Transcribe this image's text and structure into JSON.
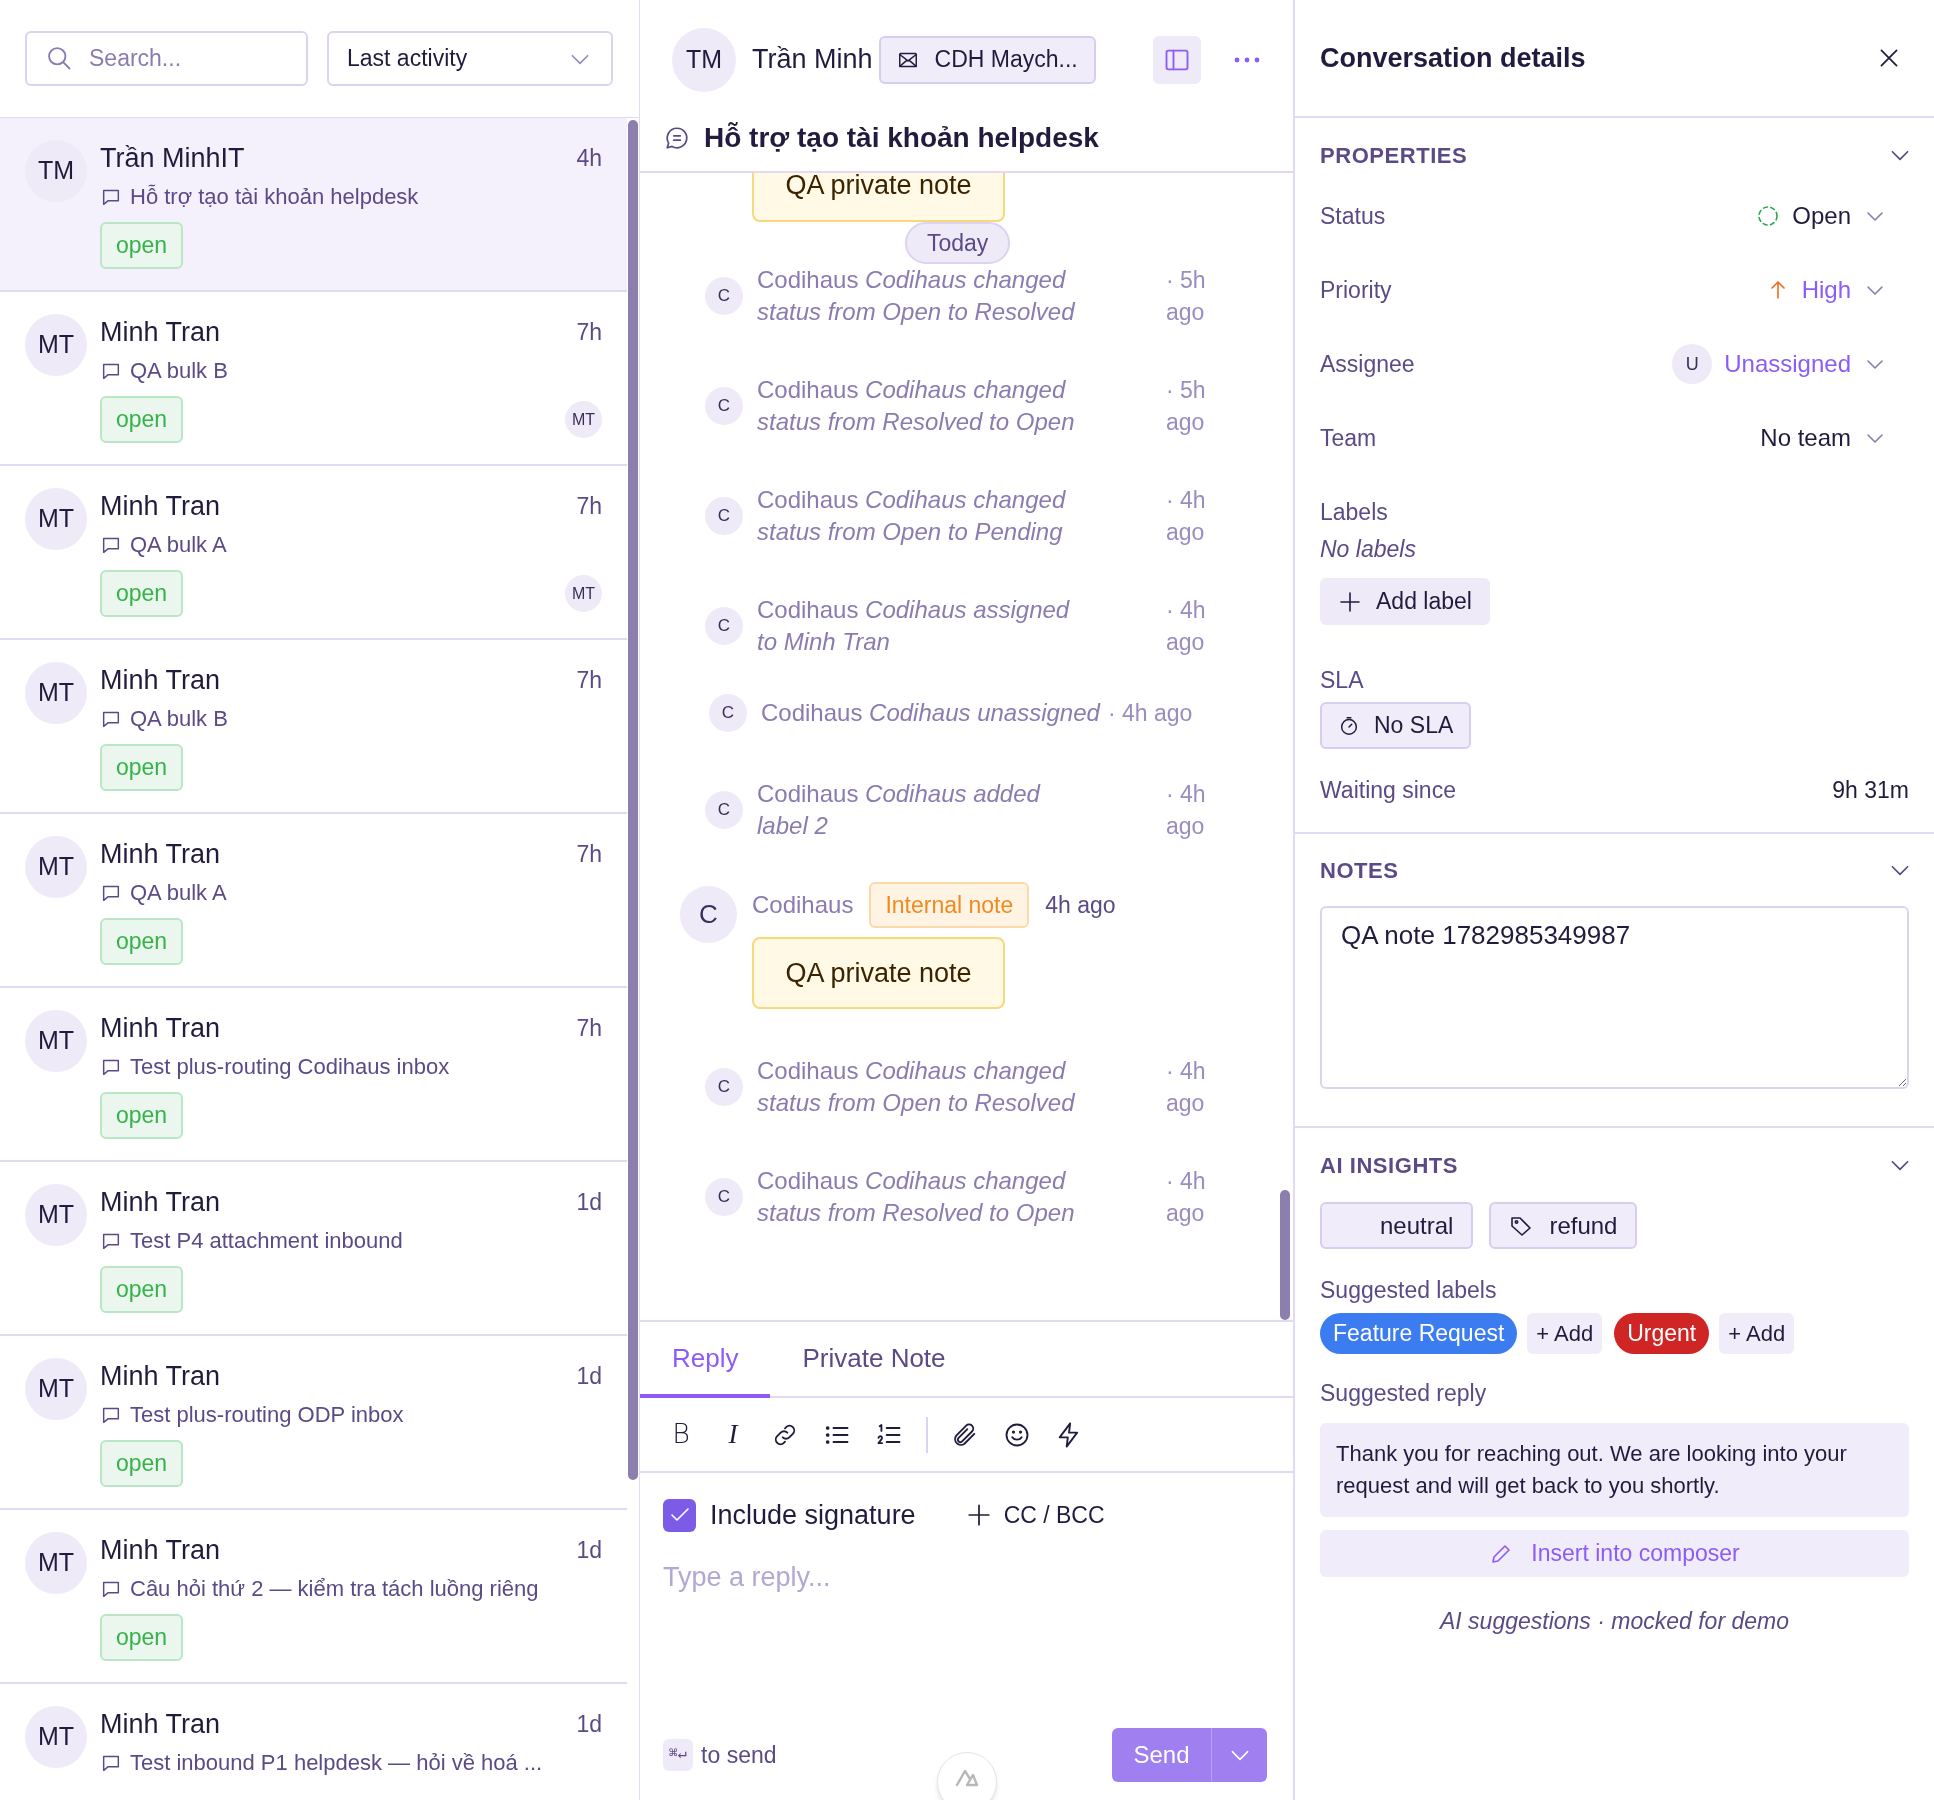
{
  "sidebar": {
    "search": {
      "placeholder": "Search..."
    },
    "sort": {
      "value": "Last activity"
    },
    "conversations": [
      {
        "initials": "TM",
        "name": "Trần MinhIT",
        "time": "4h",
        "subject": "Hỗ trợ tạo tài khoản helpdesk",
        "status": "open",
        "selected": true
      },
      {
        "initials": "MT",
        "name": "Minh Tran",
        "time": "7h",
        "subject": "QA bulk B",
        "status": "open",
        "assignee_initials": "MT",
        "selected": false
      },
      {
        "initials": "MT",
        "name": "Minh Tran",
        "time": "7h",
        "subject": "QA bulk A",
        "status": "open",
        "assignee_initials": "MT",
        "selected": false
      },
      {
        "initials": "MT",
        "name": "Minh Tran",
        "time": "7h",
        "subject": "QA bulk B",
        "status": "open",
        "selected": false
      },
      {
        "initials": "MT",
        "name": "Minh Tran",
        "time": "7h",
        "subject": "QA bulk A",
        "status": "open",
        "selected": false
      },
      {
        "initials": "MT",
        "name": "Minh Tran",
        "time": "7h",
        "subject": "Test plus-routing Codihaus inbox",
        "status": "open",
        "selected": false
      },
      {
        "initials": "MT",
        "name": "Minh Tran",
        "time": "1d",
        "subject": "Test P4 attachment inbound",
        "status": "open",
        "selected": false
      },
      {
        "initials": "MT",
        "name": "Minh Tran",
        "time": "1d",
        "subject": "Test plus-routing ODP inbox",
        "status": "open",
        "selected": false
      },
      {
        "initials": "MT",
        "name": "Minh Tran",
        "time": "1d",
        "subject": "Câu hỏi thứ 2 — kiểm tra tách luồng riêng",
        "status": "open",
        "selected": false
      },
      {
        "initials": "MT",
        "name": "Minh Tran",
        "time": "1d",
        "subject": "Test inbound P1 helpdesk — hỏi về hoá ...",
        "selected": false
      }
    ]
  },
  "conversation": {
    "header": {
      "initials": "TM",
      "name": "Trần Minh",
      "inbox": "CDH Maych..."
    },
    "title": "Hỗ trợ tạo tài khoản helpdesk",
    "timeline": [
      {
        "kind": "note_tail",
        "text": "QA private note"
      },
      {
        "kind": "date",
        "text": "Today"
      },
      {
        "kind": "event",
        "avatar": "C",
        "text": "Codihaus *Codihaus changed status from Open to Resolved*",
        "time": "· 5h ago"
      },
      {
        "kind": "event",
        "avatar": "C",
        "text": "Codihaus *Codihaus changed status from Resolved to Open*",
        "time": "· 5h ago"
      },
      {
        "kind": "event",
        "avatar": "C",
        "text": "Codihaus *Codihaus changed status from Open to Pending*",
        "time": "· 4h ago"
      },
      {
        "kind": "event",
        "avatar": "C",
        "text": "Codihaus *Codihaus assigned to Minh Tran*",
        "time": "· 4h ago"
      },
      {
        "kind": "event_inline",
        "avatar": "C",
        "text": "Codihaus *Codihaus unassigned*",
        "time": "· 4h ago"
      },
      {
        "kind": "event",
        "avatar": "C",
        "text": "Codihaus *Codihaus added label 2*",
        "time": "· 4h ago"
      },
      {
        "kind": "note",
        "avatar": "C",
        "author": "Codihaus",
        "badge": "Internal note",
        "time": "4h ago",
        "text": "QA private note"
      },
      {
        "kind": "event",
        "avatar": "C",
        "text": "Codihaus *Codihaus changed status from Open to Resolved*",
        "time": "· 4h ago"
      },
      {
        "kind": "event",
        "avatar": "C",
        "text": "Codihaus *Codihaus changed status from Resolved to Open*",
        "time": "· 4h ago"
      }
    ],
    "composer": {
      "tabs": [
        {
          "label": "Reply",
          "selected": true
        },
        {
          "label": "Private Note",
          "selected": false
        }
      ],
      "toolbar": [
        {
          "kind": "bold",
          "glyph": "B"
        },
        {
          "kind": "italic",
          "glyph": "I"
        },
        {
          "kind": "link"
        },
        {
          "kind": "bullets"
        },
        {
          "kind": "numbered"
        },
        {
          "kind": "separator"
        },
        {
          "kind": "attach"
        },
        {
          "kind": "emoji"
        },
        {
          "kind": "bolt"
        }
      ],
      "signature": {
        "label": "Include signature",
        "checked": true
      },
      "cc_bcc": "CC / BCC",
      "placeholder": "Type a reply...",
      "shortcut": "⌘↵",
      "shortcut_label": "to send",
      "send": "Send"
    }
  },
  "details": {
    "title": "Conversation details",
    "properties": {
      "heading": "PROPERTIES",
      "fields": [
        {
          "kind": "status",
          "label": "Status",
          "value": "Open"
        },
        {
          "kind": "priority",
          "label": "Priority",
          "value": "High"
        },
        {
          "kind": "assignee",
          "label": "Assignee",
          "avatar": "U",
          "value": "Unassigned"
        },
        {
          "kind": "team",
          "label": "Team",
          "value": "No team"
        }
      ],
      "labels_label": "Labels",
      "labels_empty": "No labels",
      "add_label": "Add label",
      "sla_label": "SLA",
      "sla_value": "No SLA",
      "waiting_label": "Waiting since",
      "waiting_value": "9h 31m"
    },
    "notes": {
      "heading": "NOTES",
      "value": "QA note 1782985349987"
    },
    "ai": {
      "heading": "AI INSIGHTS",
      "chips": [
        {
          "kind": "sentiment",
          "text": "neutral"
        },
        {
          "kind": "tag",
          "text": "refund"
        }
      ],
      "suggested_labels_title": "Suggested labels",
      "suggested_labels": [
        {
          "name": "Feature Request",
          "color": "#3b7cf0",
          "add": "+ Add"
        },
        {
          "name": "Urgent",
          "color": "#d02525",
          "add": "+ Add"
        }
      ],
      "suggested_reply_title": "Suggested reply",
      "suggested_reply": "Thank you for reaching out. We are looking into your request and will get back to you shortly.",
      "insert": "Insert into composer",
      "footer": "AI suggestions · mocked for demo"
    }
  }
}
